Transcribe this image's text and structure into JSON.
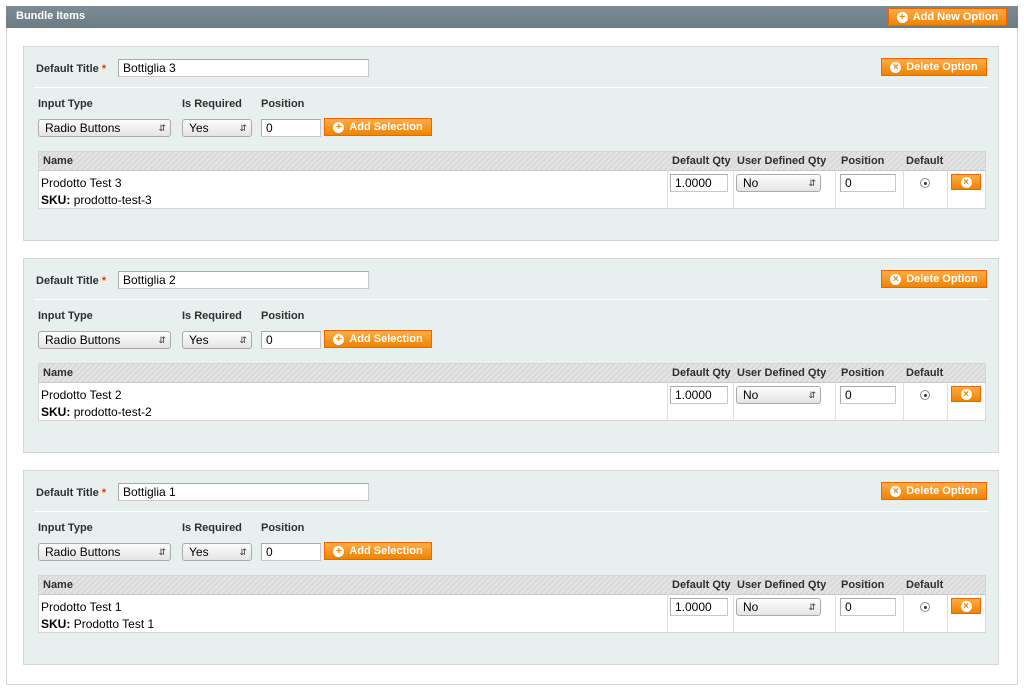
{
  "section": {
    "title": "Bundle Items",
    "add_option_label": "Add New Option"
  },
  "labels": {
    "default_title": "Default Title",
    "required_mark": "*",
    "input_type": "Input Type",
    "is_required": "Is Required",
    "position": "Position",
    "delete_option": "Delete Option",
    "add_selection": "Add Selection",
    "sku_prefix": "SKU:"
  },
  "grid_headers": {
    "name": "Name",
    "default_qty": "Default Qty",
    "user_defined_qty": "User Defined Qty",
    "position": "Position",
    "default": "Default"
  },
  "options": [
    {
      "title": "Bottiglia 3",
      "input_type": "Radio Buttons",
      "is_required": "Yes",
      "position": "0",
      "selection": {
        "name": "Prodotto Test 3",
        "sku": "prodotto-test-3",
        "default_qty": "1.0000",
        "user_defined_qty": "No",
        "position": "0",
        "is_default": true
      }
    },
    {
      "title": "Bottiglia 2",
      "input_type": "Radio Buttons",
      "is_required": "Yes",
      "position": "0",
      "selection": {
        "name": "Prodotto Test 2",
        "sku": "prodotto-test-2",
        "default_qty": "1.0000",
        "user_defined_qty": "No",
        "position": "0",
        "is_default": true
      }
    },
    {
      "title": "Bottiglia 1",
      "input_type": "Radio Buttons",
      "is_required": "Yes",
      "position": "0",
      "selection": {
        "name": "Prodotto Test 1",
        "sku": "Prodotto Test 1",
        "default_qty": "1.0000",
        "user_defined_qty": "No",
        "position": "0",
        "is_default": true
      }
    }
  ],
  "icons": {
    "add": "plus-circle-icon",
    "delete": "x-circle-icon",
    "select_arrow": "updown-arrow-icon"
  },
  "colors": {
    "header_bar": "#6b7c85",
    "option_bg": "#e7efef",
    "button_orange": "#f18200",
    "required": "#eb340a"
  }
}
